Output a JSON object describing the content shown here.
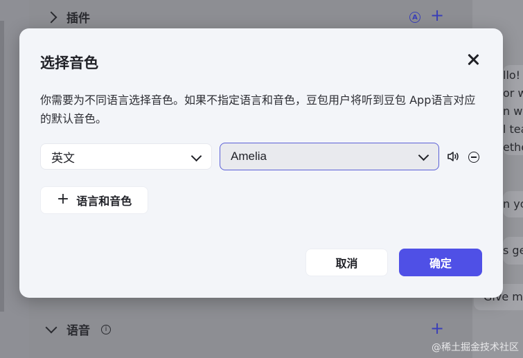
{
  "background": {
    "plugins_label": "插件",
    "voice_label": "语音",
    "chat_fragments": [
      "llo! h",
      "or w",
      "n wit",
      "l tea",
      "ethe",
      "n you",
      "s ge",
      "Give m"
    ],
    "watermark": "@稀土掘金技术社区"
  },
  "modal": {
    "title": "选择音色",
    "description": "你需要为不同语言选择音色。如果不指定语言和音色，豆包用户将听到豆包 App语言对应的默认音色。",
    "language_select": "英文",
    "voice_select": "Amelia",
    "add_button": "语言和音色",
    "cancel_button": "取消",
    "confirm_button": "确定"
  },
  "colors": {
    "primary": "#4f50e6",
    "modal_bg": "#f3f5f9"
  }
}
